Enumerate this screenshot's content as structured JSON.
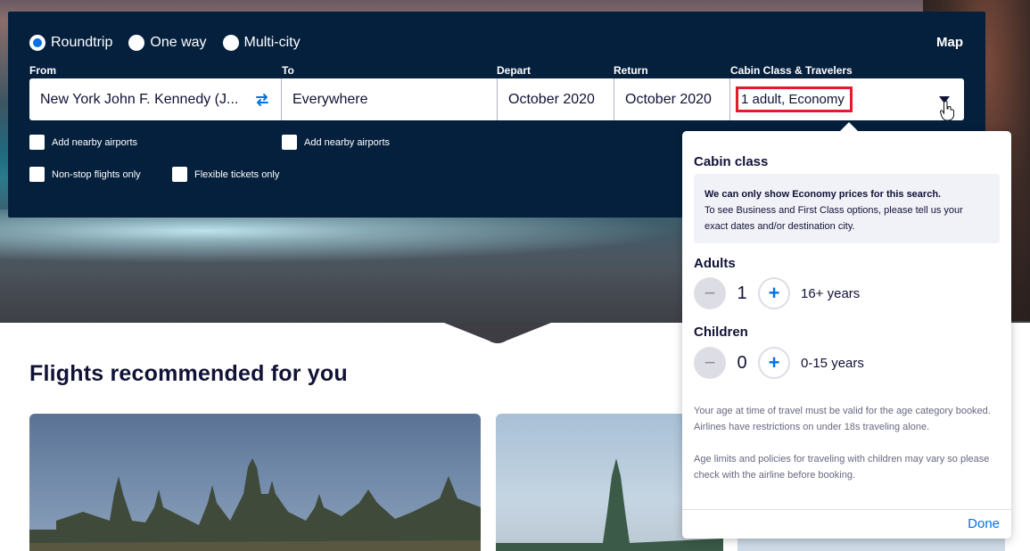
{
  "trip_types": [
    {
      "label": "Roundtrip",
      "checked": true
    },
    {
      "label": "One way",
      "checked": false
    },
    {
      "label": "Multi-city",
      "checked": false
    }
  ],
  "map_label": "Map",
  "labels": {
    "from": "From",
    "to": "To",
    "depart": "Depart",
    "return": "Return",
    "cabin": "Cabin Class & Travelers"
  },
  "values": {
    "from": "New York John F. Kennedy (J...",
    "to": "Everywhere",
    "depart": "October 2020",
    "return": "October 2020",
    "cabin": "1 adult, Economy"
  },
  "checkboxes": {
    "nearby_from": "Add nearby airports",
    "nearby_to": "Add nearby airports",
    "nonstop": "Non-stop flights only",
    "flexible": "Flexible tickets only"
  },
  "recommendations": {
    "title": "Flights recommended for you"
  },
  "popover": {
    "cabin_heading": "Cabin class",
    "info_bold": "We can only show Economy prices for this search.",
    "info_text": "To see Business and First Class options, please tell us your exact dates and/or destination city.",
    "adults_heading": "Adults",
    "adults_count": "1",
    "adults_note": "16+ years",
    "children_heading": "Children",
    "children_count": "0",
    "children_note": "0-15 years",
    "note1": "Your age at time of travel must be valid for the age category booked. Airlines have restrictions on under 18s traveling alone.",
    "note2": "Age limits and policies for traveling with children may vary so please check with the airline before booking.",
    "done_label": "Done",
    "minus_symbol": "−",
    "plus_symbol": "+"
  },
  "colors": {
    "panel": "#05203c",
    "accent": "#0770e3",
    "highlight": "#e21a2c"
  }
}
